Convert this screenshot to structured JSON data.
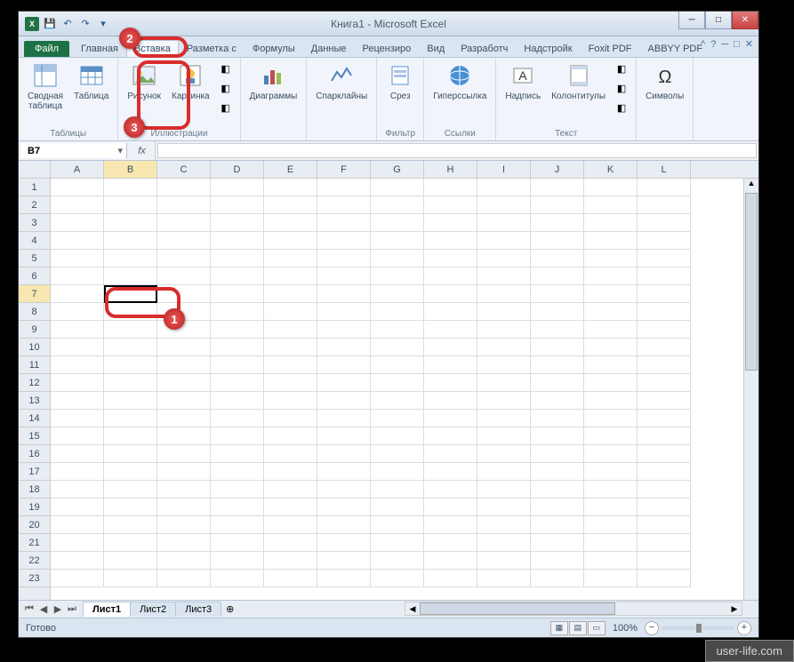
{
  "window": {
    "title": "Книга1 - Microsoft Excel",
    "controls": {
      "min": "─",
      "max": "□",
      "close": "✕"
    }
  },
  "tabs": {
    "file": "Файл",
    "items": [
      "Главная",
      "Вставка",
      "Разметка с",
      "Формулы",
      "Данные",
      "Рецензиро",
      "Вид",
      "Разработч",
      "Надстройк",
      "Foxit PDF",
      "ABBYY PDF"
    ],
    "active_index": 1,
    "help": "?"
  },
  "ribbon": {
    "groups": [
      {
        "label": "Таблицы",
        "buttons": [
          {
            "name": "pivot-table-button",
            "label": "Сводная\nтаблица",
            "icon": "pivot"
          },
          {
            "name": "table-button",
            "label": "Таблица",
            "icon": "table"
          }
        ]
      },
      {
        "label": "Иллюстрации",
        "buttons": [
          {
            "name": "picture-button",
            "label": "Рисунок",
            "icon": "picture"
          },
          {
            "name": "clipart-button",
            "label": "Картинка",
            "icon": "clipart"
          }
        ],
        "small": [
          "shapes",
          "smartart",
          "screenshot"
        ]
      },
      {
        "label": "",
        "buttons": [
          {
            "name": "charts-button",
            "label": "Диаграммы",
            "icon": "chart"
          }
        ]
      },
      {
        "label": "",
        "buttons": [
          {
            "name": "sparklines-button",
            "label": "Спарклайны",
            "icon": "spark"
          }
        ]
      },
      {
        "label": "Фильтр",
        "buttons": [
          {
            "name": "slicer-button",
            "label": "Срез",
            "icon": "slicer"
          }
        ]
      },
      {
        "label": "Ссылки",
        "buttons": [
          {
            "name": "hyperlink-button",
            "label": "Гиперссылка",
            "icon": "link"
          }
        ]
      },
      {
        "label": "Текст",
        "buttons": [
          {
            "name": "textbox-button",
            "label": "Надпись",
            "icon": "textbox"
          },
          {
            "name": "headerfooter-button",
            "label": "Колонтитулы",
            "icon": "hf"
          }
        ],
        "small": [
          "wordart",
          "sigline",
          "object"
        ]
      },
      {
        "label": "",
        "buttons": [
          {
            "name": "symbols-button",
            "label": "Символы",
            "icon": "symbol"
          }
        ]
      }
    ]
  },
  "namebox": {
    "value": "B7",
    "fx": "fx"
  },
  "columns": [
    "A",
    "B",
    "C",
    "D",
    "E",
    "F",
    "G",
    "H",
    "I",
    "J",
    "K",
    "L"
  ],
  "rows": [
    1,
    2,
    3,
    4,
    5,
    6,
    7,
    8,
    9,
    10,
    11,
    12,
    13,
    14,
    15,
    16,
    17,
    18,
    19,
    20,
    21,
    22,
    23
  ],
  "active": {
    "col": 1,
    "row": 6
  },
  "sheets": {
    "items": [
      "Лист1",
      "Лист2",
      "Лист3"
    ],
    "active_index": 0
  },
  "status": {
    "ready": "Готово",
    "zoom": "100%"
  },
  "callouts": {
    "c1": "1",
    "c2": "2",
    "c3": "3"
  },
  "watermark": "user-life.com"
}
